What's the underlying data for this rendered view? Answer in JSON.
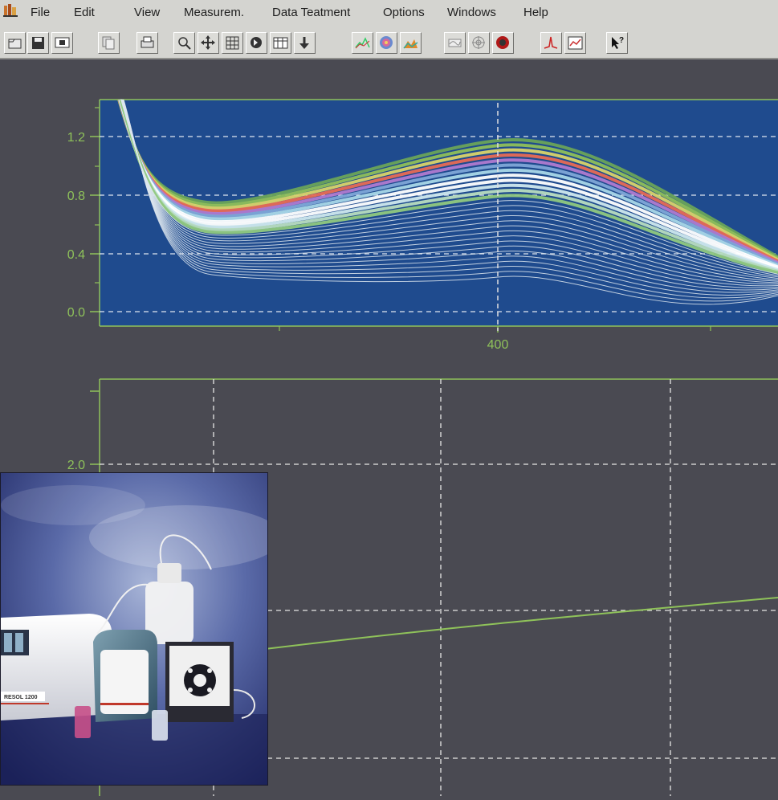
{
  "menu": [
    {
      "key": "file",
      "label": "File"
    },
    {
      "key": "edit",
      "label": "Edit"
    },
    {
      "key": "view",
      "label": "View"
    },
    {
      "key": "measurem",
      "label": "Measurem."
    },
    {
      "key": "data-teatment",
      "label": "Data Teatment"
    },
    {
      "key": "options",
      "label": "Options"
    },
    {
      "key": "windows",
      "label": "Windows"
    },
    {
      "key": "help",
      "label": "Help"
    }
  ],
  "toolbar": {
    "buttons": [
      "open-icon",
      "save-icon",
      "display-icon",
      "copy-icon",
      "print-icon",
      "zoom-icon",
      "move-icon",
      "grid-icon",
      "cursor-icon",
      "table-icon",
      "down-arrow-icon",
      "spectrum-icon",
      "color-wheel-icon",
      "peaks-icon",
      "smooth-icon",
      "target-icon",
      "record-icon",
      "peak-icon",
      "chart-window-icon",
      "help-pointer-icon"
    ]
  },
  "colors": {
    "spectrum_bg": "#1f4b8e",
    "axis_green": "#8fc25a",
    "workspace_bg": "#4a4a52",
    "kinetic_line": "#8fc25a"
  },
  "chart_data": [
    {
      "type": "line",
      "title": "",
      "y_ticks": [
        "1.2",
        "0.8",
        "0.4",
        "0.0"
      ],
      "x_ticks": [
        "400"
      ],
      "grid": true,
      "cursor_x": "400",
      "series": []
    },
    {
      "type": "line",
      "title": "",
      "y_ticks": [
        "2.0"
      ],
      "grid": true,
      "series": []
    }
  ]
}
